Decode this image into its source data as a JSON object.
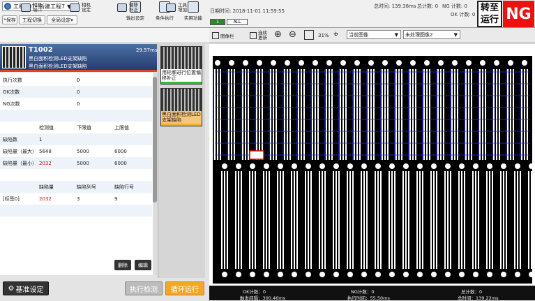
{
  "project": {
    "name": "工程007--新建工程7"
  },
  "toolbar": {
    "save": "*保存",
    "switch": "工程切换",
    "global": "全局设定",
    "output": "输出设定",
    "cond": "条件执行",
    "util": "实用功能"
  },
  "status": {
    "datetime": "日期时间: 2018-11-01 11:59:55",
    "total_time": "总时间: 139.38ms",
    "total_count": "总计数: 0",
    "ng_count": "NG 计数: 0",
    "ok_count": "OK 计数: 0",
    "chip1": "1",
    "chip_all": "ALL"
  },
  "run_button": "转至运行",
  "ng_badge": "NG",
  "section": {
    "cam_port": "相机\n端口",
    "cam_set": "相机\n设定",
    "offset": "偏移\n补正",
    "tool_add": "工具\n增加"
  },
  "tool": {
    "id": "T1002",
    "time": "29.57ms",
    "name1": "黑白面积检测LED支架缺陷",
    "name2": "黑白面积检测LED支架缺陷"
  },
  "stats": [
    {
      "label": "执行次数",
      "value": "0"
    },
    {
      "label": "OK次数",
      "value": "0"
    },
    {
      "label": "NG次数",
      "value": "0"
    }
  ],
  "meas_headers": {
    "measured": "检测值",
    "lower": "下限值",
    "upper": "上限值"
  },
  "meas_rows": [
    {
      "label": "缺陷数",
      "measured": "1",
      "lower": "",
      "upper": ""
    },
    {
      "label": "缺陷量（最大）",
      "measured": "5648",
      "lower": "5000",
      "upper": "6000"
    },
    {
      "label": "缺陷量（最小）",
      "measured": "2032",
      "lower": "5000",
      "upper": "6000"
    }
  ],
  "defect_headers": {
    "amount": "缺陷量",
    "col": "缺陷列号",
    "row": "缺陷行号"
  },
  "defect_rows": [
    {
      "label": "[标签0]",
      "amount": "2032",
      "col": "3",
      "row": "9"
    }
  ],
  "actions": {
    "delete": "删除",
    "edit": "编辑"
  },
  "flow": [
    {
      "label": "用轮廓进行位置偏移补正",
      "status_color": "#2fbf3a"
    },
    {
      "label": "黑白面积检测LED支架缺陷",
      "status_color": "#f0b030"
    }
  ],
  "bottom": {
    "base": "基准设定",
    "exec": "执行检测",
    "loop": "循环运行"
  },
  "view": {
    "gallery": "图像栏",
    "conn": "连续\n更新",
    "zoom": "31%",
    "image_select": "当前图像",
    "proc_select": "未处理图像2"
  },
  "footer": {
    "ok": "OK计数：0",
    "ng": "NG计数：0",
    "total": "总计数：0",
    "trigger": "触发间隔：300.46ms",
    "exec_time": "执行时间：55.50ms",
    "total_time": "总时间：139.22ms"
  }
}
